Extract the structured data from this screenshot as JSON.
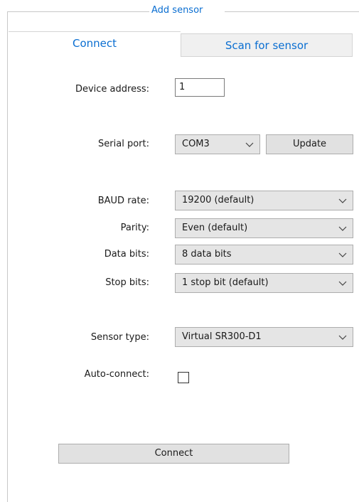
{
  "group": {
    "title": "Add sensor"
  },
  "tabs": [
    {
      "label": "Connect",
      "active": true
    },
    {
      "label": "Scan for sensor",
      "active": false
    }
  ],
  "form": {
    "device_address": {
      "label": "Device address:",
      "value": "1"
    },
    "serial_port": {
      "label": "Serial port:",
      "value": "COM3",
      "update_label": "Update"
    },
    "baud_rate": {
      "label": "BAUD rate:",
      "value": "19200 (default)"
    },
    "parity": {
      "label": "Parity:",
      "value": "Even (default)"
    },
    "data_bits": {
      "label": "Data bits:",
      "value": "8 data bits"
    },
    "stop_bits": {
      "label": "Stop bits:",
      "value": "1 stop bit (default)"
    },
    "sensor_type": {
      "label": "Sensor type:",
      "value": "Virtual SR300-D1"
    },
    "auto_connect": {
      "label": "Auto-connect:",
      "checked": false
    }
  },
  "actions": {
    "connect_label": "Connect"
  },
  "colors": {
    "accent": "#0a6ed1",
    "combo_bg": "#e5e5e5",
    "button_bg": "#e1e1e1"
  }
}
